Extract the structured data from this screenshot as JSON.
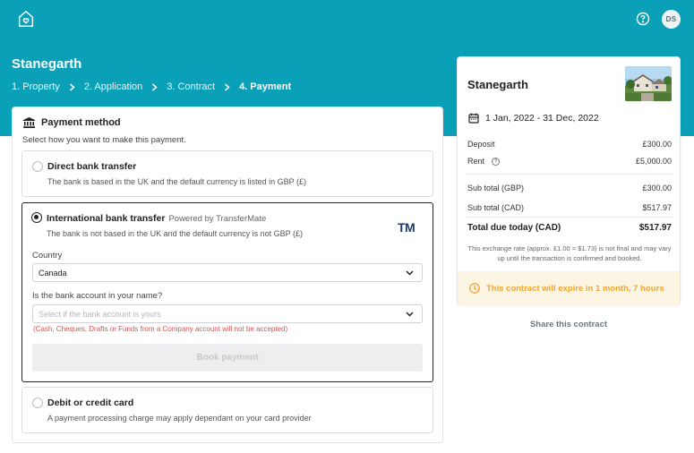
{
  "header": {
    "avatar_initials": "DS",
    "logo_icon": "home-heart-icon",
    "help_icon": "help-circle-icon"
  },
  "property": {
    "title": "Stanegarth"
  },
  "breadcrumb": {
    "items": [
      "1. Property",
      "2. Application",
      "3. Contract",
      "4. Payment"
    ],
    "active_index": 3
  },
  "payment": {
    "heading": "Payment method",
    "subheading": "Select how you want to make this payment.",
    "options": [
      {
        "title": "Direct bank transfer",
        "description": "The bank is based in the UK and the default currency is listed in GBP (£)",
        "selected": false
      },
      {
        "title": "International bank transfer",
        "powered_by": "Powered by TransferMate",
        "brand_mark": "TM",
        "description": "The bank is not based in the UK and the default currency is not GBP (£)",
        "selected": true,
        "country_label": "Country",
        "country_value": "Canada",
        "account_label": "Is the bank account in your name?",
        "account_placeholder": "Select if the bank account is yours",
        "warning": "(Cash, Cheques, Drafts or Funds from a Company account will not be accepted)",
        "book_button": "Book payment"
      },
      {
        "title": "Debit or credit card",
        "description": "A payment processing charge may apply dependant on your card provider",
        "selected": false
      }
    ]
  },
  "summary": {
    "title": "Stanegarth",
    "dates": "1 Jan, 2022 - 31 Dec, 2022",
    "lines": [
      {
        "label": "Deposit",
        "value": "£300.00"
      },
      {
        "label": "Rent",
        "value": "£5,000.00"
      }
    ],
    "subtotals": [
      {
        "label": "Sub total (GBP)",
        "value": "£300.00"
      },
      {
        "label": "Sub total (CAD)",
        "value": "$517.97"
      }
    ],
    "total": {
      "label": "Total due today (CAD)",
      "value": "$517.97"
    },
    "fx_note": "This exchange rate (approx. £1.00 = $1.73) is not final and may vary up until the transaction is confirmed and booked.",
    "expiry": "This contract will expire in 1 month, 7 hours"
  },
  "share_link": "Share this contract",
  "colors": {
    "brand": "#0aa0b8",
    "expiry_text": "#f0a630",
    "expiry_bg": "#fdf5e4",
    "warning": "#d9534f"
  }
}
